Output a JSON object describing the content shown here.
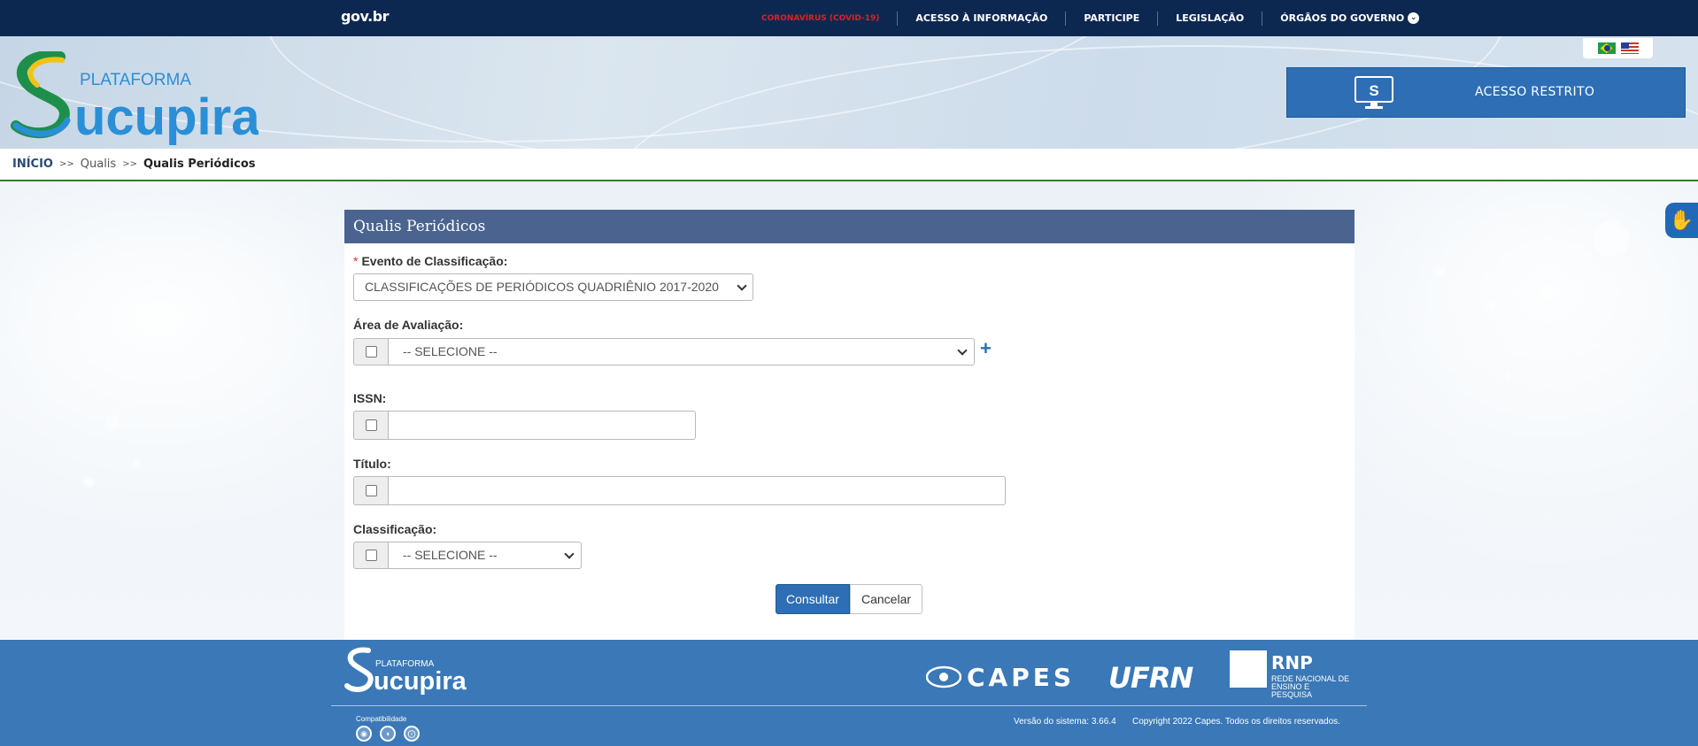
{
  "govbar": {
    "logo": "gov.br",
    "links": [
      {
        "label": "CORONAVÍRUS (COVID-19)"
      },
      {
        "label": "ACESSO À INFORMAÇÃO"
      },
      {
        "label": "PARTICIPE"
      },
      {
        "label": "LEGISLAÇÃO"
      },
      {
        "label": "ÓRGÃOS DO GOVERNO"
      }
    ]
  },
  "header": {
    "logo_top": "PLATAFORMA",
    "logo_main": "ucupira",
    "restricted_label": "ACESSO RESTRITO",
    "flags": [
      "brazil-flag-icon",
      "usa-flag-icon"
    ]
  },
  "breadcrumb": {
    "home": "INÍCIO",
    "sep": ">>",
    "section": "Qualis",
    "current": "Qualis Periódicos"
  },
  "form": {
    "title": "Qualis Periódicos",
    "evento_label": "Evento de Classificação:",
    "evento_value": "CLASSIFICAÇÕES DE PERIÓDICOS QUADRIÊNIO 2017-2020",
    "area_label": "Área de Avaliação:",
    "area_value": "-- SELECIONE --",
    "issn_label": "ISSN:",
    "titulo_label": "Título:",
    "classificacao_label": "Classificação:",
    "classificacao_value": "-- SELECIONE --",
    "submit": "Consultar",
    "cancel": "Cancelar",
    "required_mark": "*",
    "add_symbol": "+"
  },
  "footer": {
    "logo_top": "PLATAFORMA",
    "logo_main": "ucupira",
    "capes": "CAPES",
    "ufrn": "UFRN",
    "rnp": "RNP",
    "rnp_sub": "REDE NACIONAL DE ENSINO E PESQUISA",
    "compat_label": "Compatibilidade",
    "browsers": [
      "chrome-icon",
      "firefox-icon",
      "safari-icon"
    ],
    "version": "Versão do sistema: 3.66.4",
    "copyright": "Copyright 2022 Capes. Todos os direitos reservados."
  },
  "colors": {
    "govbar": "#0c2851",
    "accent": "#2e6eb4",
    "panel_header": "#4a648f",
    "footer": "#3a78b7",
    "covid": "#e02020"
  }
}
